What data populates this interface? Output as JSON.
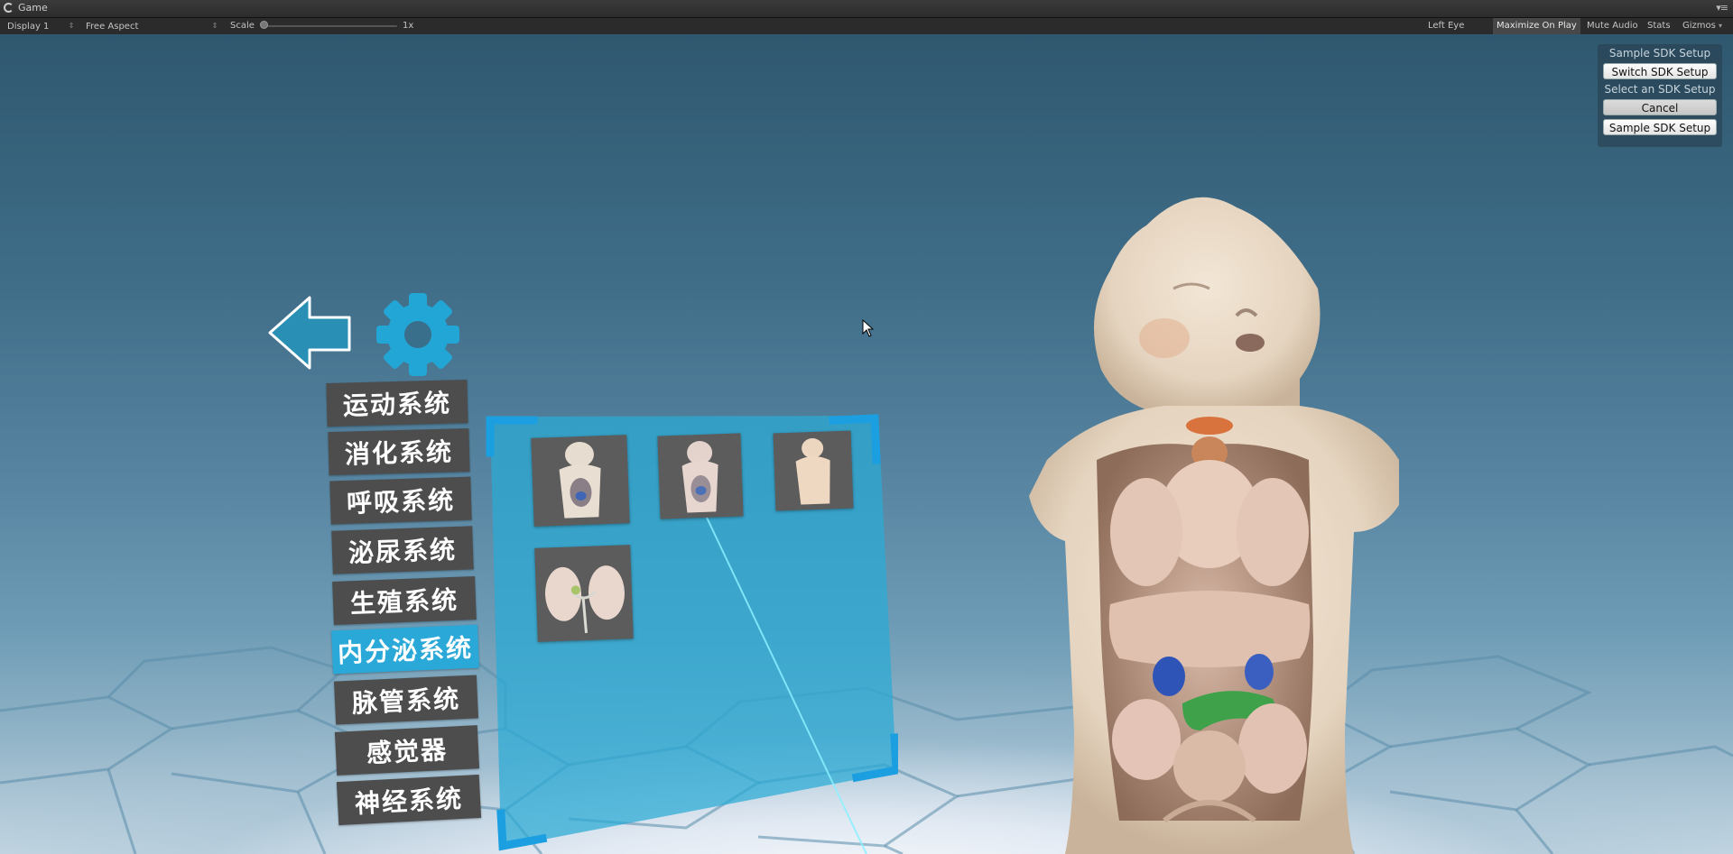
{
  "window": {
    "tab_title": "Game"
  },
  "toolbar": {
    "display": "Display 1",
    "aspect": "Free Aspect",
    "scale_label": "Scale",
    "scale_value": "1x",
    "eye": "Left Eye",
    "maximize_on_play": "Maximize On Play",
    "mute_audio": "Mute Audio",
    "stats": "Stats",
    "gizmos": "Gizmos"
  },
  "sdk_panel": {
    "title": "Sample SDK Setup",
    "switch_button": "Switch SDK Setup",
    "select_label": "Select an SDK Setup",
    "cancel_button": "Cancel",
    "option_button": "Sample SDK Setup"
  },
  "menu": {
    "items": [
      {
        "label": "运动系统"
      },
      {
        "label": "消化系统"
      },
      {
        "label": "呼吸系统"
      },
      {
        "label": "泌尿系统"
      },
      {
        "label": "生殖系统"
      },
      {
        "label": "内分泌系统"
      },
      {
        "label": "脉管系统"
      },
      {
        "label": "感觉器"
      },
      {
        "label": "神经系统"
      }
    ],
    "active_index": 5
  },
  "icons": {
    "back": "back-arrow-icon",
    "settings": "gear-icon",
    "cursor": "mouse-cursor-icon"
  },
  "colors": {
    "accent": "#2aa9d8",
    "menu_bg": "#4d4d4d",
    "panel_bg": "#2aaad6"
  }
}
